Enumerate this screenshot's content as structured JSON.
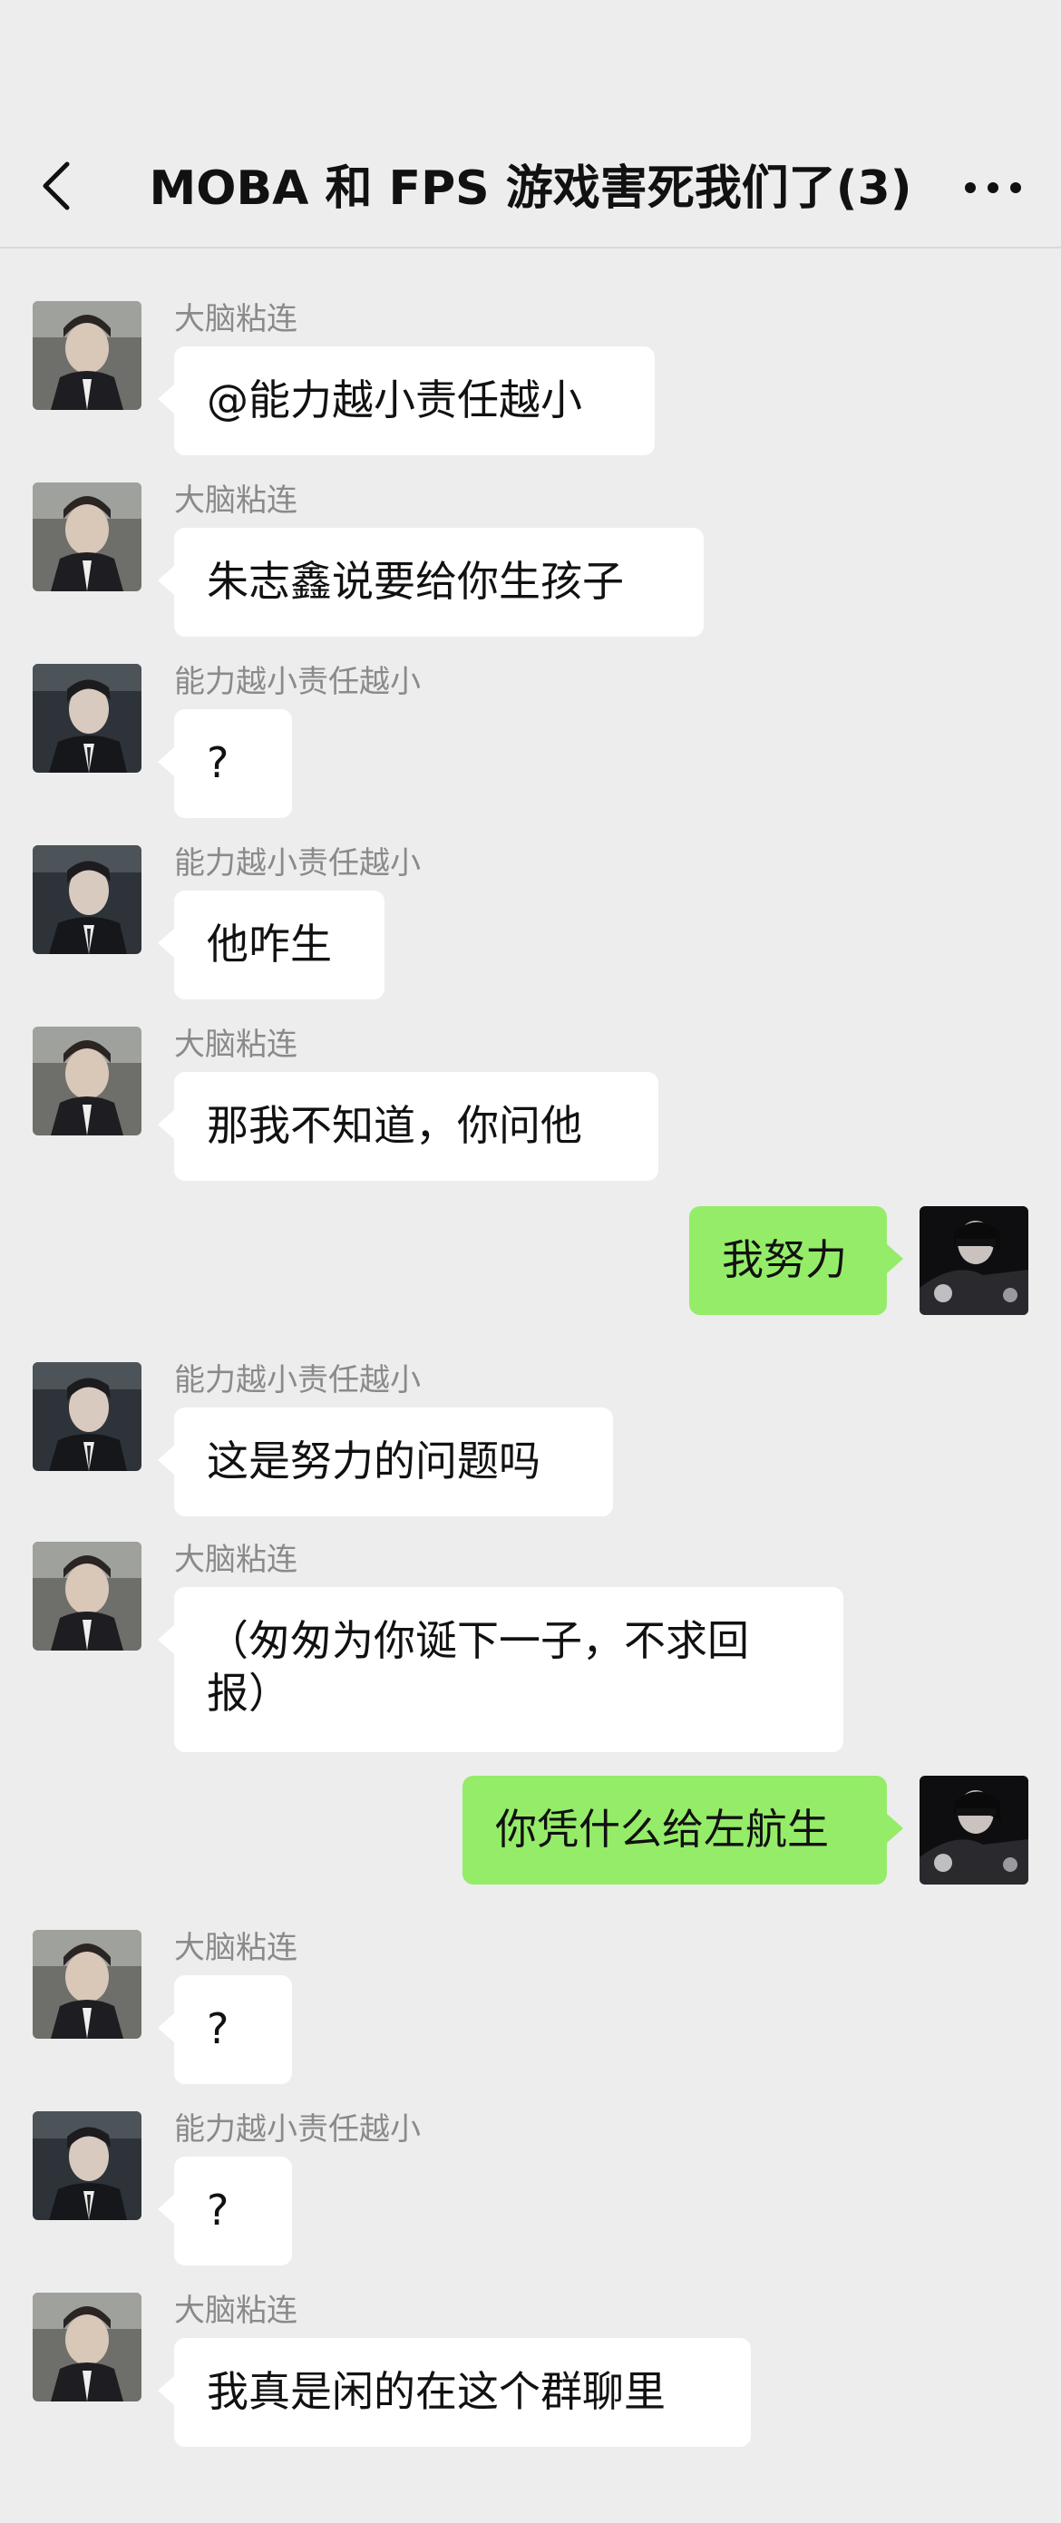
{
  "header": {
    "title": "MOBA 和 FPS 游戏害死我们了(3)",
    "back_icon": "chevron-left-icon",
    "more_icon": "ellipsis-icon"
  },
  "colors": {
    "background": "#EDEDED",
    "incoming_bubble": "#FFFFFF",
    "outgoing_bubble": "#95EC69",
    "sender_name": "#8A8A8A"
  },
  "messages": [
    {
      "side": "left",
      "avatar": "avatar-dnzl",
      "sender": "大脑粘连",
      "text": "@能力越小责任越小"
    },
    {
      "side": "left",
      "avatar": "avatar-dnzl",
      "sender": "大脑粘连",
      "text": "朱志鑫说要给你生孩子"
    },
    {
      "side": "left",
      "avatar": "avatar-nlyx",
      "sender": "能力越小责任越小",
      "text": "?"
    },
    {
      "side": "left",
      "avatar": "avatar-nlyx",
      "sender": "能力越小责任越小",
      "text": "他咋生"
    },
    {
      "side": "left",
      "avatar": "avatar-dnzl",
      "sender": "大脑粘连",
      "text": "那我不知道，你问他"
    },
    {
      "side": "right",
      "avatar": "avatar-self",
      "sender": "",
      "text": "我努力"
    },
    {
      "side": "left",
      "avatar": "avatar-nlyx",
      "sender": "能力越小责任越小",
      "text": "这是努力的问题吗"
    },
    {
      "side": "left",
      "avatar": "avatar-dnzl",
      "sender": "大脑粘连",
      "text": "（匆匆为你诞下一子，不求回",
      "text2": "报）"
    },
    {
      "side": "right",
      "avatar": "avatar-self",
      "sender": "",
      "text": "你凭什么给左航生"
    },
    {
      "side": "left",
      "avatar": "avatar-dnzl",
      "sender": "大脑粘连",
      "text": "?"
    },
    {
      "side": "left",
      "avatar": "avatar-nlyx",
      "sender": "能力越小责任越小",
      "text": "?"
    },
    {
      "side": "left",
      "avatar": "avatar-dnzl",
      "sender": "大脑粘连",
      "text": "我真是闲的在这个群聊里"
    }
  ]
}
